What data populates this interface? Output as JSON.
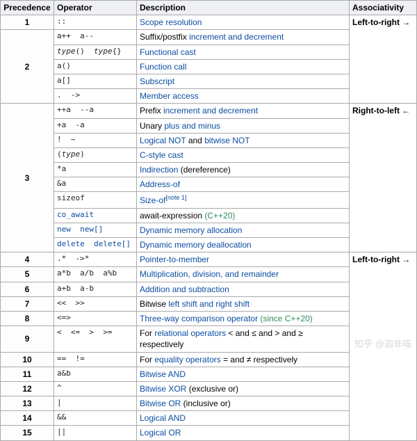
{
  "headers": {
    "c1": "Precedence",
    "c2": "Operator",
    "c3": "Description",
    "c4": "Associativity"
  },
  "labels": {
    "arrow_ltr": "Left-to-right →",
    "arrow_rtl": "Right-to-left ←",
    "since_cpp20": "(since C++20)",
    "cpp20": "(C++20)",
    "note1": "[note 1]"
  },
  "rows": {
    "r1": {
      "prec": "1",
      "op": "::",
      "desc_link": "Scope resolution"
    },
    "r2a": {
      "prec": "2",
      "op": "a++  a--",
      "txt1": "Suffix/postfix ",
      "link": "increment and decrement"
    },
    "r2b": {
      "op_html": "<i>type</i>()  <i>type</i>{}",
      "link": "Functional cast"
    },
    "r2c": {
      "op": "a()",
      "link": "Function call"
    },
    "r2d": {
      "op": "a[]",
      "link": "Subscript"
    },
    "r2e": {
      "op": ".  ->",
      "link": "Member access"
    },
    "r3a": {
      "prec": "3",
      "op": "++a  --a",
      "txt1": "Prefix ",
      "link": "increment and decrement"
    },
    "r3b": {
      "op": "+a  -a",
      "txt1": "Unary ",
      "link": "plus and minus"
    },
    "r3c": {
      "op": "!  ~",
      "link1": "Logical NOT",
      "mid": " and ",
      "link2": "bitwise NOT"
    },
    "r3d": {
      "op_html": "(<i>type</i>)",
      "link": "C-style cast"
    },
    "r3e": {
      "op": "*a",
      "link": "Indirection",
      "tail": " (dereference)"
    },
    "r3f": {
      "op": "&a",
      "link": "Address-of"
    },
    "r3g": {
      "op": "sizeof",
      "link": "Size-of"
    },
    "r3h": {
      "op": "co_await",
      "txt": "await-expression "
    },
    "r3i": {
      "op": "new  new[]",
      "link": "Dynamic memory allocation"
    },
    "r3j": {
      "op": "delete  delete[]",
      "link": "Dynamic memory deallocation"
    },
    "r4": {
      "prec": "4",
      "op": ".*  ->*",
      "link": "Pointer-to-member"
    },
    "r5": {
      "prec": "5",
      "op": "a*b  a/b  a%b",
      "link": "Multiplication, division, and remainder"
    },
    "r6": {
      "prec": "6",
      "op": "a+b  a-b",
      "link": "Addition and subtraction"
    },
    "r7": {
      "prec": "7",
      "op": "<<  >>",
      "txt1": "Bitwise ",
      "link": "left shift and right shift"
    },
    "r8": {
      "prec": "8",
      "op": "<=>",
      "link": "Three-way comparison operator",
      "tail": " "
    },
    "r9": {
      "prec": "9",
      "op": "<  <=  >  >=",
      "txt1": "For ",
      "link": "relational operators",
      "tail": " < and ≤ and > and ≥ respectively"
    },
    "r10": {
      "prec": "10",
      "op": "==  !=",
      "txt1": "For ",
      "link": "equality operators",
      "tail": " = and ≠ respectively"
    },
    "r11": {
      "prec": "11",
      "op": "a&b",
      "link": "Bitwise AND"
    },
    "r12": {
      "prec": "12",
      "op": "^",
      "link": "Bitwise XOR",
      "tail": " (exclusive or)"
    },
    "r13": {
      "prec": "13",
      "op": "|",
      "link": "Bitwise OR",
      "tail": " (inclusive or)"
    },
    "r14": {
      "prec": "14",
      "op": "&&",
      "link": "Logical AND"
    },
    "r15": {
      "prec": "15",
      "op": "||",
      "link": "Logical OR"
    }
  },
  "watermark": "知乎 @迦非喵"
}
